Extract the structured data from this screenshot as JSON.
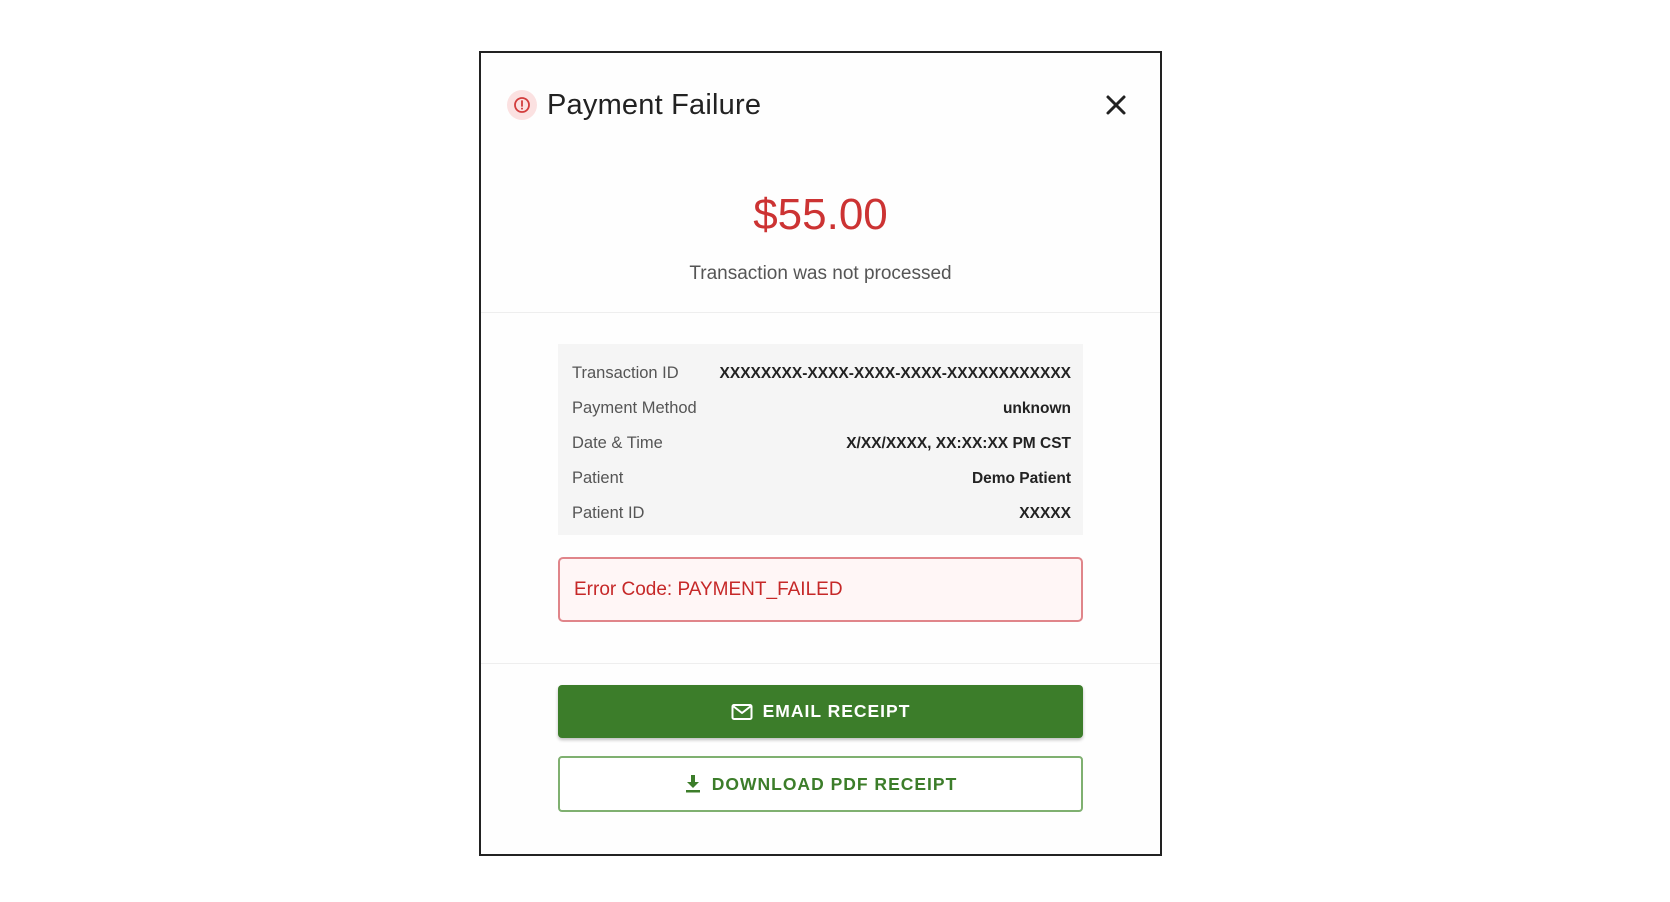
{
  "dialog": {
    "title": "Payment Failure",
    "status_icon": "alert-circle-icon",
    "close_icon": "close-icon",
    "amount": "$55.00",
    "status_message": "Transaction was not processed"
  },
  "details": [
    {
      "label": "Transaction ID",
      "value": "XXXXXXXX-XXXX-XXXX-XXXX-XXXXXXXXXXXX"
    },
    {
      "label": "Payment Method",
      "value": "unknown"
    },
    {
      "label": "Date & Time",
      "value": "X/XX/XXXX, XX:XX:XX PM CST"
    },
    {
      "label": "Patient",
      "value": "Demo Patient"
    },
    {
      "label": "Patient ID",
      "value": "XXXXX"
    }
  ],
  "error": {
    "message": "Error Code: PAYMENT_FAILED"
  },
  "actions": {
    "email_label": "EMAIL RECEIPT",
    "email_icon": "mail-icon",
    "download_label": "DOWNLOAD PDF RECEIPT",
    "download_icon": "download-icon"
  },
  "colors": {
    "error_red": "#cc3333",
    "primary_green": "#3c7d2a",
    "error_border": "#e0858a"
  }
}
